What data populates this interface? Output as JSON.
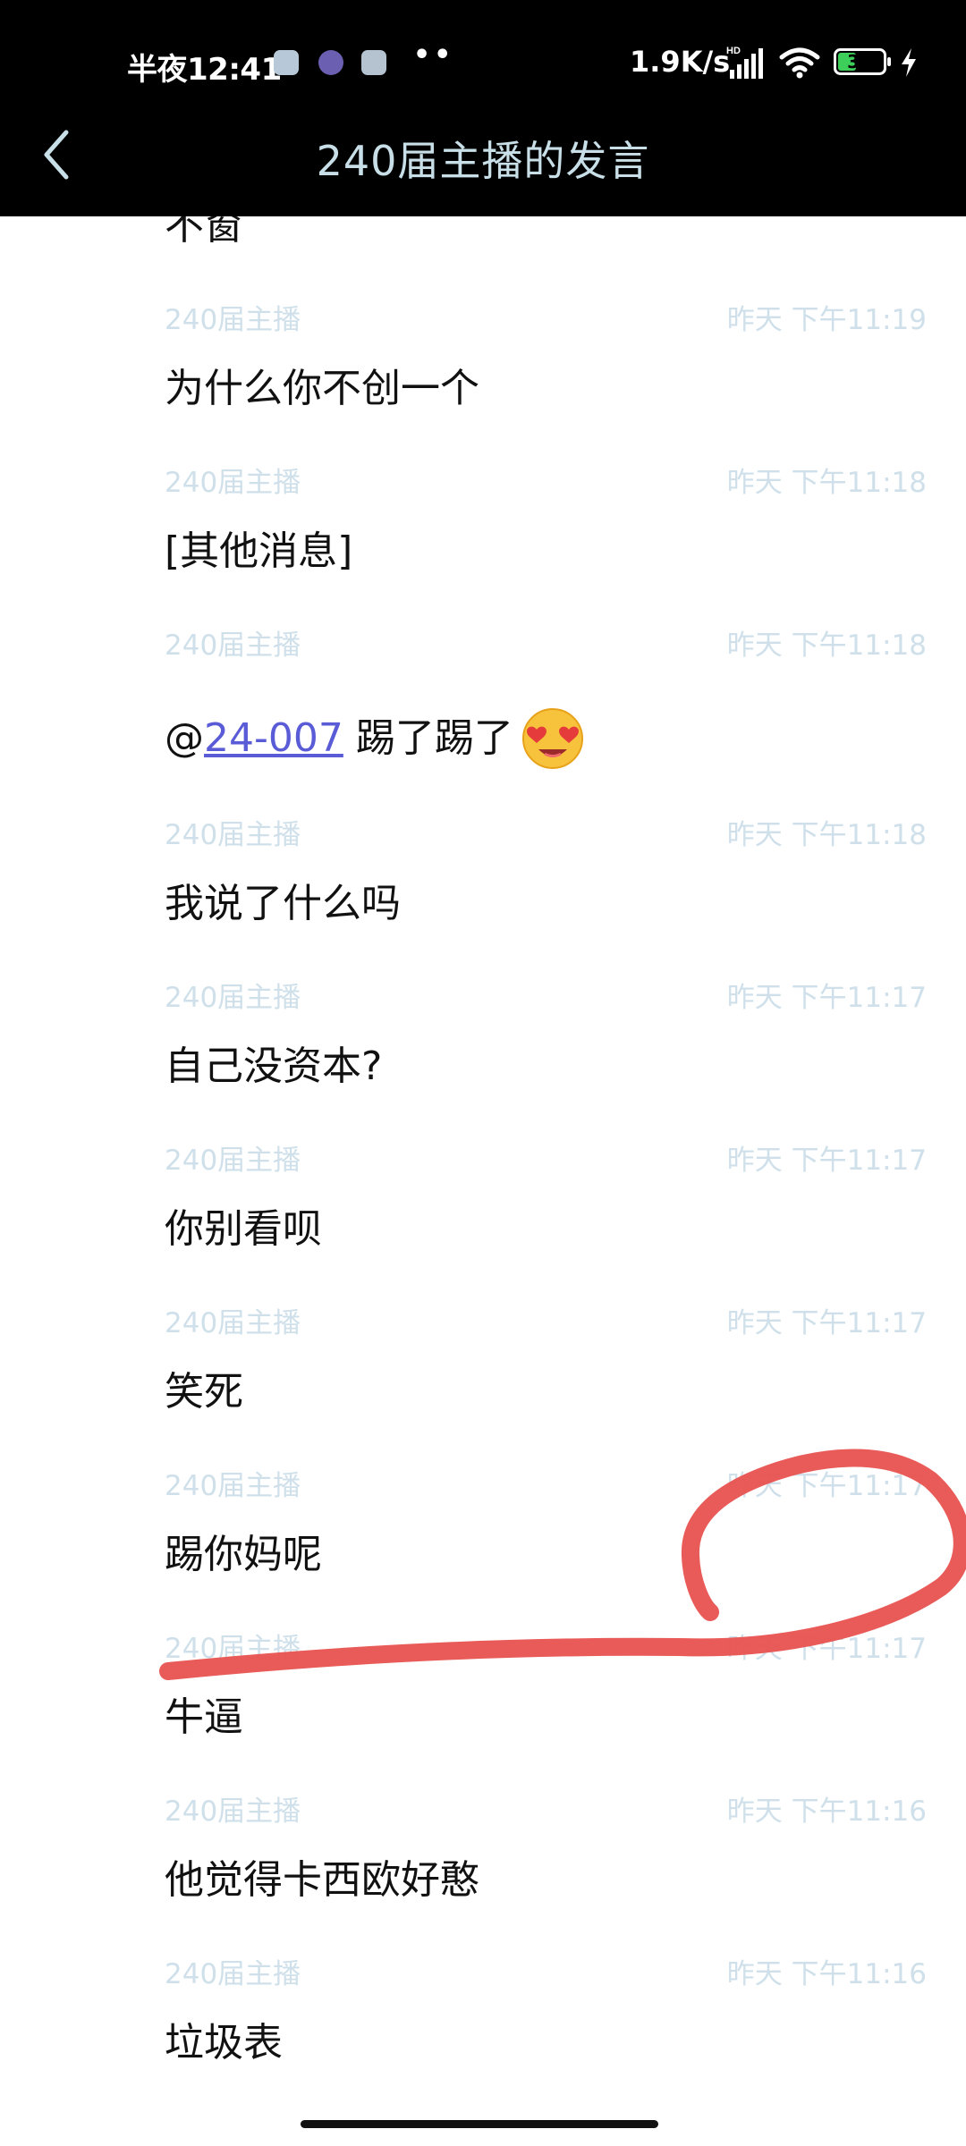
{
  "status_bar": {
    "time": "半夜12:41",
    "dots": "••",
    "network_speed": "1.9K/s",
    "battery": "33"
  },
  "header": {
    "title": "240届主播的发言"
  },
  "messages": [
    {
      "sender": "",
      "time": "",
      "text": "不窗"
    },
    {
      "sender": "240届主播",
      "time": "昨天 下午11:19",
      "text": "为什么你不创一个"
    },
    {
      "sender": "240届主播",
      "time": "昨天 下午11:18",
      "text": "[其他消息]"
    },
    {
      "sender": "240届主播",
      "time": "昨天 下午11:18",
      "text_prefix": "@",
      "mention": "24-007",
      "text_suffix": " 踢了踢了"
    },
    {
      "sender": "240届主播",
      "time": "昨天 下午11:18",
      "text": "我说了什么吗"
    },
    {
      "sender": "240届主播",
      "time": "昨天 下午11:17",
      "text": "自己没资本?"
    },
    {
      "sender": "240届主播",
      "time": "昨天 下午11:17",
      "text": "你别看呗"
    },
    {
      "sender": "240届主播",
      "time": "昨天 下午11:17",
      "text": "笑死"
    },
    {
      "sender": "240届主播",
      "time": "昨天 下午11:17",
      "text": "踢你妈呢"
    },
    {
      "sender": "240届主播",
      "time": "昨天 下午11:17",
      "text": "牛逼"
    },
    {
      "sender": "240届主播",
      "time": "昨天 下午11:16",
      "text": "他觉得卡西欧好憨"
    },
    {
      "sender": "240届主播",
      "time": "昨天 下午11:16",
      "text": "垃圾表"
    }
  ],
  "colors": {
    "header_bg": "#000000",
    "title_color": "#c8dfe8",
    "meta_text": "#cfe0ea",
    "message_text": "#111111",
    "mention_link": "#5a5bd6",
    "annotation_red": "#e8524f"
  },
  "icons": {
    "back": "chevron-left-icon",
    "emoji": "heart-eyes-emoji-icon",
    "signal": "signal-bars-icon",
    "wifi": "wifi-icon",
    "battery": "battery-icon",
    "charge": "lightning-icon"
  }
}
